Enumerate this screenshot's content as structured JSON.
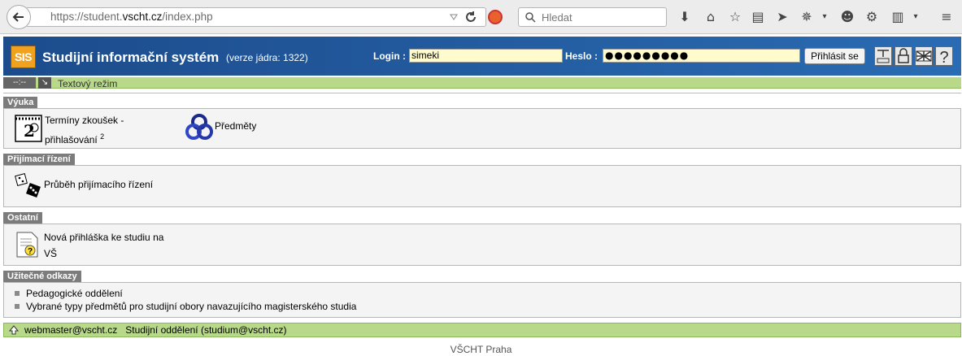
{
  "browser": {
    "url_prefix": "https://student.",
    "url_domain": "vscht.cz",
    "url_suffix": "/index.php",
    "search_placeholder": "Hledat"
  },
  "header": {
    "logo": "SIS",
    "title": "Studijní informační systém",
    "version": "(verze jádra: 1322)",
    "login_label": "Login :",
    "login_value": "simeki",
    "password_label": "Heslo :",
    "password_value": "●●●●●●●●●",
    "login_button": "Přihlásit se"
  },
  "toolbar": {
    "clock": "--:--",
    "text_mode": "Textový režim"
  },
  "sections": {
    "vyuka": {
      "title": "Výuka",
      "items": {
        "terminy_line1": "Termíny zkoušek -",
        "terminy_line2": "přihlašování",
        "terminy_badge": "2",
        "predmety": "Předměty"
      }
    },
    "prijimaci": {
      "title": "Přijímací řízení",
      "item": "Průběh přijímacího řízení"
    },
    "ostatni": {
      "title": "Ostatní",
      "item_line1": "Nová přihláška ke studiu na",
      "item_line2": "VŠ"
    },
    "odkazy": {
      "title": "Užitečné odkazy",
      "links": [
        "Pedagogické oddělení",
        "Vybrané typy předmětů pro studijní obory navazujícího magisterského studia"
      ]
    }
  },
  "footer": {
    "webmaster": "webmaster@vscht.cz",
    "office": "Studijní oddělení (studium@vscht.cz)",
    "bottom": "VŠCHT Praha"
  },
  "colors": {
    "header_blue": "#1c4c8c",
    "accent_green": "#b8d98a",
    "section_gray": "#7c7c7c"
  }
}
